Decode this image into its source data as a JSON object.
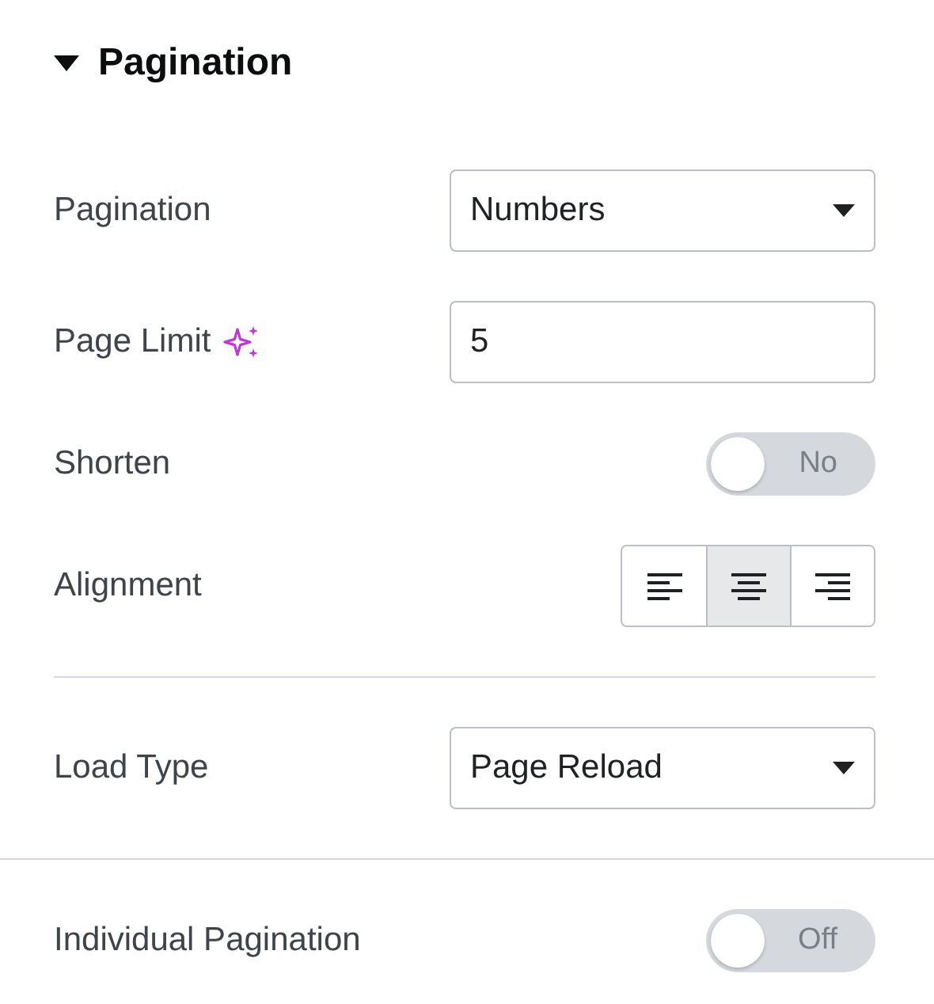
{
  "section": {
    "title": "Pagination",
    "expanded": true
  },
  "controls": [
    {
      "kind": "select",
      "label": "Pagination",
      "value": "Numbers"
    },
    {
      "kind": "input",
      "label": "Page Limit",
      "ai": true,
      "value": "5"
    },
    {
      "kind": "toggle",
      "label": "Shorten",
      "on": false,
      "state_text": "No"
    },
    {
      "kind": "align",
      "label": "Alignment",
      "options": [
        {
          "kind": "left",
          "selected": false
        },
        {
          "kind": "center",
          "selected": true
        },
        {
          "kind": "right",
          "selected": false
        }
      ]
    },
    {
      "kind": "divider",
      "inset": true
    },
    {
      "kind": "select",
      "label": "Load Type",
      "value": "Page Reload"
    },
    {
      "kind": "divider",
      "inset": false
    },
    {
      "kind": "toggle",
      "label": "Individual Pagination",
      "on": false,
      "state_text": "Off"
    }
  ]
}
